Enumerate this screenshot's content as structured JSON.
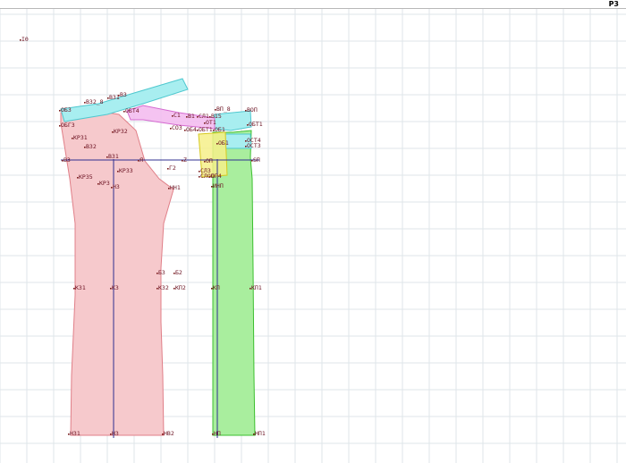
{
  "window": {
    "corner_tag": "Р3"
  },
  "canvas": {
    "origin_label": "I0",
    "grid_color": "#dfe6ea",
    "colors": {
      "back_fill": "#f6c9cc",
      "back_stroke": "#e07f88",
      "front_fill": "#a9ee9e",
      "front_stroke": "#3cbf2f",
      "cyan_fill": "#a8eef0",
      "cyan_stroke": "#4ec8cf",
      "magenta_fill": "#f3b8ef",
      "magenta_stroke": "#d46ad0",
      "yellow_fill": "#f6f08a",
      "yellow_stroke": "#d6c81e",
      "axis_line": "#303090",
      "label_color": "#6a1020"
    },
    "labels": {
      "b32_8": "В32_8",
      "b31_top": "В31",
      "b3_top": "В3",
      "ob3": "ОБ3",
      "obt4": "ОБТ4",
      "c1": "С1",
      "b1": "В1",
      "cnn": "СЛ1",
      "b15": "В15",
      "bp_8": "ВП_8",
      "bop": "ВОП",
      "obg3": "ОБГ3",
      "co3": "СО3",
      "ob4": "ОБ4",
      "obt1_a": "ОБТ1",
      "ot1": "ОТ1",
      "obt1_b": "ОБТ1",
      "kr31": "КР31",
      "kr32": "КР32",
      "b32": "В32",
      "ob1": "ОБ1",
      "ob1b": "ОБ1",
      "ost4": "ОСТ4",
      "ost3": "ОСТ3",
      "b3_axis": "В3",
      "b31_mid": "В31",
      "ya": "Я",
      "z": "Z",
      "op": "ОП",
      "sp": "SП",
      "g2": "Г2",
      "kr33": "КР33",
      "sl3": "СЛ3",
      "slop": "СЛОП",
      "op4": "ОП4",
      "kr35": "КР35",
      "kr3x": "КР3",
      "h3": "Н3",
      "hh1": "НН1",
      "inp": "ИНП",
      "b3_mid": "Б3",
      "b2_mid": "Б2",
      "k31": "К31",
      "k3": "К3",
      "k32": "К32",
      "kp2": "КП2",
      "kp": "КП",
      "kp1": "КП1",
      "h31": "Н31",
      "h3_bottom": "Н3",
      "hb2": "НВ2",
      "hp": "НП",
      "hp1": "НП1"
    }
  }
}
